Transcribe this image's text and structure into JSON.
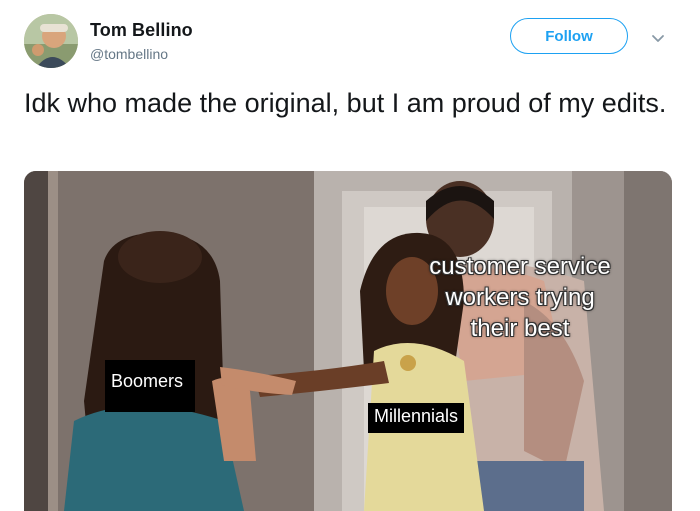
{
  "tweet": {
    "display_name": "Tom Bellino",
    "handle": "@tombellino",
    "follow_label": "Follow",
    "text": "Idk who made the original, but I am proud of my edits."
  },
  "meme": {
    "label_left": "Boomers",
    "label_center": "Millennials",
    "label_right": "customer service workers trying their best"
  },
  "icons": {
    "avatar": "profile-photo",
    "more": "chevron-down-icon"
  },
  "colors": {
    "accent": "#1da1f2",
    "text": "#14171a",
    "secondary": "#657786"
  }
}
